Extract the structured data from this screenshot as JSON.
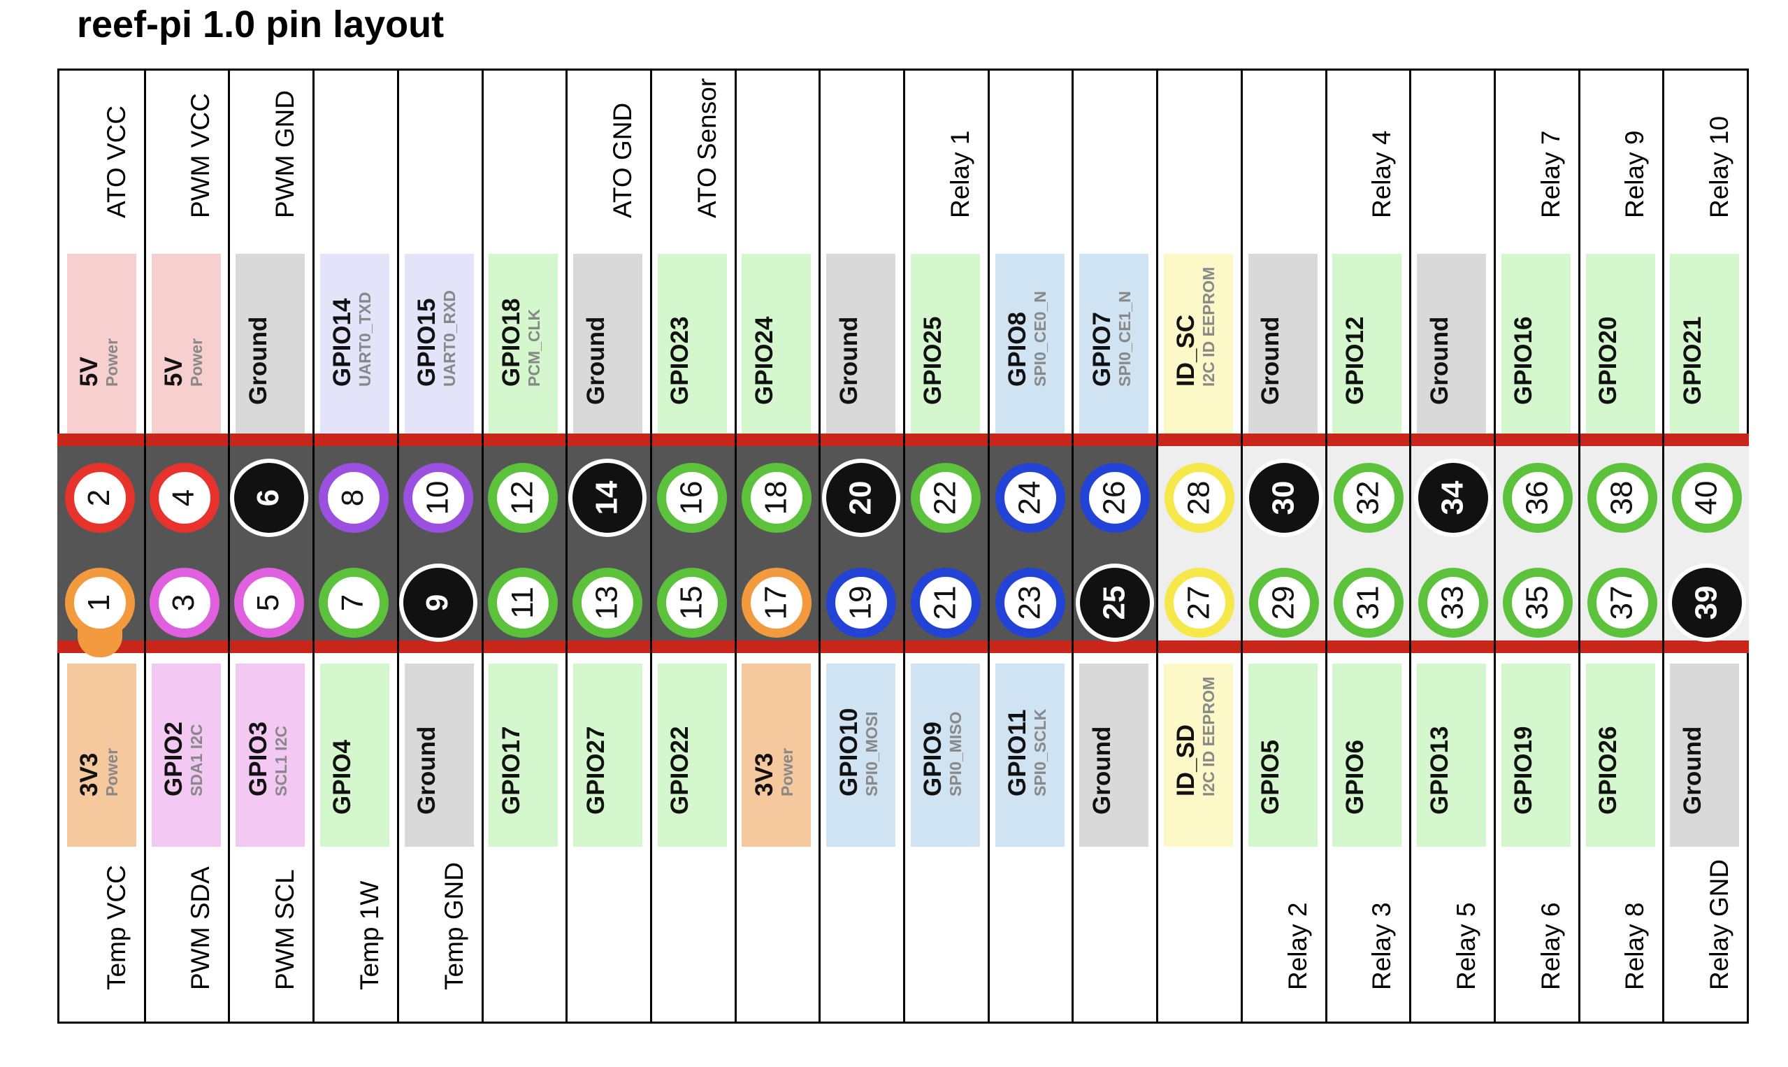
{
  "title": "reef-pi 1.0 pin layout",
  "colors": {
    "power5v": "#f7cfcf",
    "power3v3": "#f5c89e",
    "ground": "#d9d9d9",
    "gpio": "#d4f7cd",
    "uart": "#e3e3fa",
    "i2c": "#f3c8f3",
    "spi": "#cfe3f2",
    "eeprom": "#fdf8c8",
    "header_bg": "#555555",
    "header_rail": "#c9261b",
    "header_light": "#eeeeee"
  },
  "columns": [
    {
      "top_label": "ATO VCC",
      "top_pin": {
        "name": "5V",
        "sub": "Power",
        "type": "power5",
        "num": "2",
        "ring": "red"
      },
      "bottom_pin": {
        "name": "3V3",
        "sub": "Power",
        "type": "power3",
        "num": "1",
        "ring": "orange"
      },
      "bottom_label": "Temp VCC"
    },
    {
      "top_label": "PWM VCC",
      "top_pin": {
        "name": "5V",
        "sub": "Power",
        "type": "power5",
        "num": "4",
        "ring": "red"
      },
      "bottom_pin": {
        "name": "GPIO2",
        "sub": "SDA1 I2C",
        "type": "i2c",
        "num": "3",
        "ring": "magenta"
      },
      "bottom_label": "PWM SDA"
    },
    {
      "top_label": "PWM GND",
      "top_pin": {
        "name": "Ground",
        "sub": "",
        "type": "gnd",
        "num": "6",
        "ring": "black"
      },
      "bottom_pin": {
        "name": "GPIO3",
        "sub": "SCL1 I2C",
        "type": "i2c",
        "num": "5",
        "ring": "magenta"
      },
      "bottom_label": "PWM SCL"
    },
    {
      "top_label": "",
      "top_pin": {
        "name": "GPIO14",
        "sub": "UART0_TXD",
        "type": "uart",
        "num": "8",
        "ring": "purple"
      },
      "bottom_pin": {
        "name": "GPIO4",
        "sub": "",
        "type": "gpio",
        "num": "7",
        "ring": "green"
      },
      "bottom_label": "Temp 1W"
    },
    {
      "top_label": "",
      "top_pin": {
        "name": "GPIO15",
        "sub": "UART0_RXD",
        "type": "uart",
        "num": "10",
        "ring": "purple"
      },
      "bottom_pin": {
        "name": "Ground",
        "sub": "",
        "type": "gnd",
        "num": "9",
        "ring": "black"
      },
      "bottom_label": "Temp GND"
    },
    {
      "top_label": "",
      "top_pin": {
        "name": "GPIO18",
        "sub": "PCM_CLK",
        "type": "gpio",
        "num": "12",
        "ring": "green"
      },
      "bottom_pin": {
        "name": "GPIO17",
        "sub": "",
        "type": "gpio",
        "num": "11",
        "ring": "green"
      },
      "bottom_label": ""
    },
    {
      "top_label": "ATO GND",
      "top_pin": {
        "name": "Ground",
        "sub": "",
        "type": "gnd",
        "num": "14",
        "ring": "black"
      },
      "bottom_pin": {
        "name": "GPIO27",
        "sub": "",
        "type": "gpio",
        "num": "13",
        "ring": "green"
      },
      "bottom_label": ""
    },
    {
      "top_label": "ATO Sensor",
      "top_pin": {
        "name": "GPIO23",
        "sub": "",
        "type": "gpio",
        "num": "16",
        "ring": "green"
      },
      "bottom_pin": {
        "name": "GPIO22",
        "sub": "",
        "type": "gpio",
        "num": "15",
        "ring": "green"
      },
      "bottom_label": ""
    },
    {
      "top_label": "",
      "top_pin": {
        "name": "GPIO24",
        "sub": "",
        "type": "gpio",
        "num": "18",
        "ring": "green"
      },
      "bottom_pin": {
        "name": "3V3",
        "sub": "Power",
        "type": "power3",
        "num": "17",
        "ring": "orange"
      },
      "bottom_label": ""
    },
    {
      "top_label": "",
      "top_pin": {
        "name": "Ground",
        "sub": "",
        "type": "gnd",
        "num": "20",
        "ring": "black"
      },
      "bottom_pin": {
        "name": "GPIO10",
        "sub": "SPI0_MOSI",
        "type": "spi",
        "num": "19",
        "ring": "blue"
      },
      "bottom_label": ""
    },
    {
      "top_label": "Relay 1",
      "top_pin": {
        "name": "GPIO25",
        "sub": "",
        "type": "gpio",
        "num": "22",
        "ring": "green"
      },
      "bottom_pin": {
        "name": "GPIO9",
        "sub": "SPI0_MISO",
        "type": "spi",
        "num": "21",
        "ring": "blue"
      },
      "bottom_label": ""
    },
    {
      "top_label": "",
      "top_pin": {
        "name": "GPIO8",
        "sub": "SPI0_CE0_N",
        "type": "spi",
        "num": "24",
        "ring": "blue"
      },
      "bottom_pin": {
        "name": "GPIO11",
        "sub": "SPI0_SCLK",
        "type": "spi",
        "num": "23",
        "ring": "blue"
      },
      "bottom_label": ""
    },
    {
      "top_label": "",
      "top_pin": {
        "name": "GPIO7",
        "sub": "SPI0_CE1_N",
        "type": "spi",
        "num": "26",
        "ring": "blue"
      },
      "bottom_pin": {
        "name": "Ground",
        "sub": "",
        "type": "gnd",
        "num": "25",
        "ring": "black"
      },
      "bottom_label": ""
    },
    {
      "top_label": "",
      "top_pin": {
        "name": "ID_SC",
        "sub": "I2C ID EEPROM",
        "type": "eeprom",
        "num": "28",
        "ring": "yellow"
      },
      "bottom_pin": {
        "name": "ID_SD",
        "sub": "I2C ID EEPROM",
        "type": "eeprom",
        "num": "27",
        "ring": "yellow"
      },
      "bottom_label": ""
    },
    {
      "top_label": "",
      "top_pin": {
        "name": "Ground",
        "sub": "",
        "type": "gnd",
        "num": "30",
        "ring": "black"
      },
      "bottom_pin": {
        "name": "GPIO5",
        "sub": "",
        "type": "gpio",
        "num": "29",
        "ring": "green"
      },
      "bottom_label": "Relay 2"
    },
    {
      "top_label": "Relay 4",
      "top_pin": {
        "name": "GPIO12",
        "sub": "",
        "type": "gpio",
        "num": "32",
        "ring": "green"
      },
      "bottom_pin": {
        "name": "GPIO6",
        "sub": "",
        "type": "gpio",
        "num": "31",
        "ring": "green"
      },
      "bottom_label": "Relay 3"
    },
    {
      "top_label": "",
      "top_pin": {
        "name": "Ground",
        "sub": "",
        "type": "gnd",
        "num": "34",
        "ring": "black"
      },
      "bottom_pin": {
        "name": "GPIO13",
        "sub": "",
        "type": "gpio",
        "num": "33",
        "ring": "green"
      },
      "bottom_label": "Relay 5"
    },
    {
      "top_label": "Relay 7",
      "top_pin": {
        "name": "GPIO16",
        "sub": "",
        "type": "gpio",
        "num": "36",
        "ring": "green"
      },
      "bottom_pin": {
        "name": "GPIO19",
        "sub": "",
        "type": "gpio",
        "num": "35",
        "ring": "green"
      },
      "bottom_label": "Relay 6"
    },
    {
      "top_label": "Relay 9",
      "top_pin": {
        "name": "GPIO20",
        "sub": "",
        "type": "gpio",
        "num": "38",
        "ring": "green"
      },
      "bottom_pin": {
        "name": "GPIO26",
        "sub": "",
        "type": "gpio",
        "num": "37",
        "ring": "green"
      },
      "bottom_label": "Relay 8"
    },
    {
      "top_label": "Relay 10",
      "top_pin": {
        "name": "GPIO21",
        "sub": "",
        "type": "gpio",
        "num": "40",
        "ring": "green"
      },
      "bottom_pin": {
        "name": "Ground",
        "sub": "",
        "type": "gnd",
        "num": "39",
        "ring": "black"
      },
      "bottom_label": "Relay GND"
    }
  ]
}
